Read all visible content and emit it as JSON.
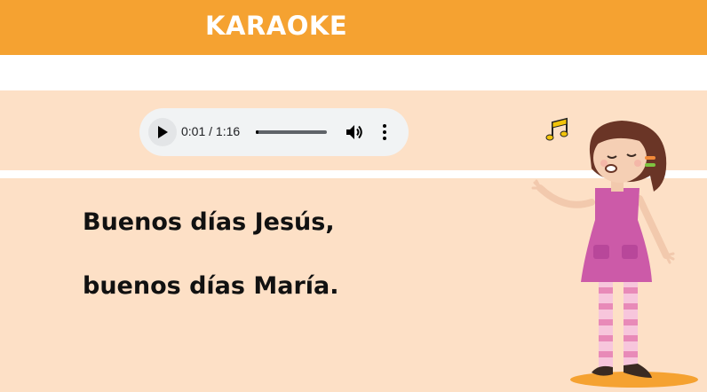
{
  "header": {
    "title": "KARAOKE"
  },
  "player": {
    "time": "0:01 / 1:16",
    "progress": 0.013,
    "play_icon": "play-icon",
    "volume_icon": "volume-icon",
    "more_icon": "more-vertical-icon"
  },
  "lyrics": {
    "line1": "Buenos días Jesús,",
    "line2": "buenos días María."
  },
  "colors": {
    "header": "#f5a231",
    "background": "#fde0c6",
    "dress": "#cc5aa8",
    "stripes": "#f0a0c8"
  }
}
